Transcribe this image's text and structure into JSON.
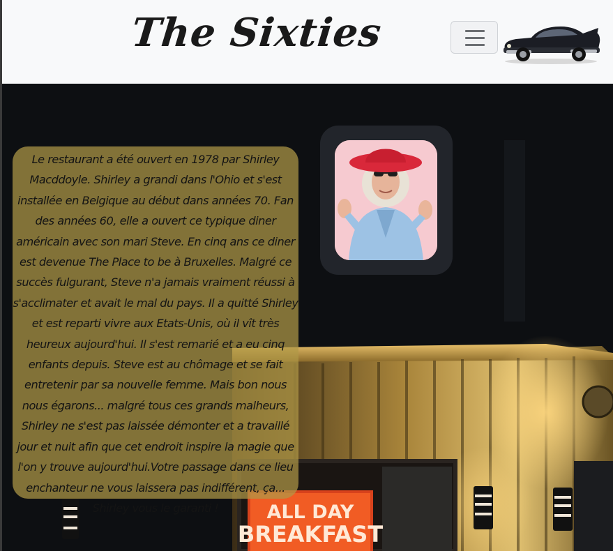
{
  "navbar": {
    "brand": "The Sixties",
    "toggler_icon": "hamburger-icon",
    "logo_icon": "vintage-car-icon"
  },
  "about": {
    "text": "Le restaurant a été ouvert en 1978 par Shirley Macddoyle. Shirley a grandi dans l'Ohio et s'est installée en Belgique au début dans années 70. Fan des années 60, elle a ouvert ce typique diner américain avec son mari Steve. En cinq ans ce diner est devenue The Place to be à Bruxelles. Malgré ce succès fulgurant, Steve n'a jamais vraiment réussi à s'acclimater et avait le mal du pays. Il a quitté Shirley et est reparti vivre aux Etats-Unis, où il vît très heureux aujourd'hui. Il s'est remarié et a eu cinq enfants depuis. Steve est au chômage et se fait entretenir par sa nouvelle femme. Mais bon nous nous égarons... malgré tous ces grands malheurs, Shirley ne s'est pas laissée démonter et a travaillé jour et nuit afin que cet endroit inspire la magie que l'on y trouve aujourd'hui.Votre passage dans ce lieu enchanteur ne vous laissera pas indifférent, ça... Shirley vous le garanti !"
  },
  "hero": {
    "sign_line1": "ALL DAY",
    "sign_line2": "BREAKFAST"
  },
  "colors": {
    "navbar_bg": "#f8f9fa",
    "card_bg": "#b09846",
    "frame_bg": "#22252b",
    "neon": "#ff6a2a"
  }
}
